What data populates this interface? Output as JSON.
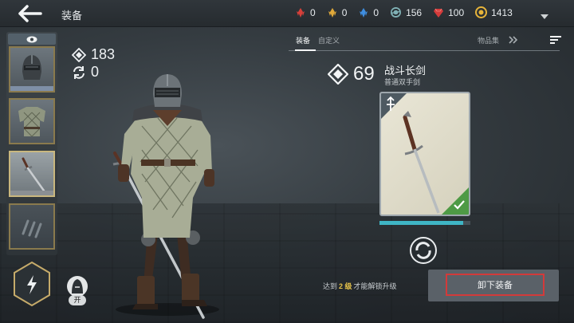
{
  "header": {
    "title": "装备",
    "currencies": [
      {
        "icon": "red-crystal-icon",
        "value": "0",
        "color": "#d8403a"
      },
      {
        "icon": "gold-crystal-icon",
        "value": "0",
        "color": "#e0a93a"
      },
      {
        "icon": "blue-crystal-icon",
        "value": "0",
        "color": "#3f8ee0"
      },
      {
        "icon": "iron-cog-icon",
        "value": "156",
        "color": "#9fc6c9"
      },
      {
        "icon": "ruby-gem-icon",
        "value": "100",
        "color": "#d43b3b"
      },
      {
        "icon": "gold-coin-icon",
        "value": "1413",
        "color": "#e6b43a"
      }
    ]
  },
  "stats": {
    "power": "183",
    "upgrades": "0"
  },
  "mode_toggle": {
    "label": "开"
  },
  "tabs": [
    {
      "label": "装备",
      "active": true
    },
    {
      "label": "自定义",
      "active": false
    },
    {
      "label": "物品集",
      "active": false
    }
  ],
  "weapon": {
    "power": "69",
    "name": "战斗长剑",
    "type": "普通双手剑",
    "progress_fraction": 0.92
  },
  "unlock_note": {
    "prefix": "达到",
    "level": "2 级",
    "suffix": "才能解锁升级"
  },
  "unequip_label": "卸下装备",
  "colors": {
    "accent_red": "#d33a3a",
    "progress": "#3fb5c5",
    "level_highlight": "#e6c34a",
    "slot_border": "#8a7a4d"
  }
}
